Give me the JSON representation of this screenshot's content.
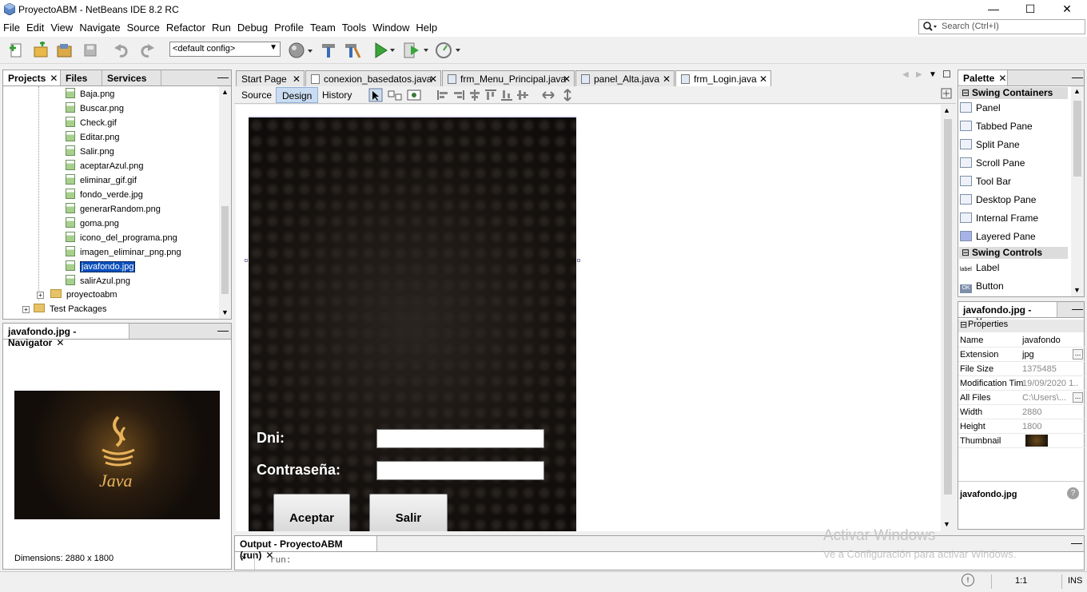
{
  "window": {
    "title": "ProyectoABM - NetBeans IDE 8.2 RC",
    "min": "—",
    "max": "☐",
    "close": "✕"
  },
  "menu": [
    "File",
    "Edit",
    "View",
    "Navigate",
    "Source",
    "Refactor",
    "Run",
    "Debug",
    "Profile",
    "Team",
    "Tools",
    "Window",
    "Help"
  ],
  "search": {
    "placeholder": "Search (Ctrl+I)"
  },
  "toolbar": {
    "config": "<default config>"
  },
  "projects": {
    "tabs": [
      "Projects",
      "Files",
      "Services"
    ],
    "files": [
      "Baja.png",
      "Buscar.png",
      "Check.gif",
      "Editar.png",
      "Salir.png",
      "aceptarAzul.png",
      "eliminar_gif.gif",
      "fondo_verde.jpg",
      "generarRandom.png",
      "goma.png",
      "icono_del_programa.png",
      "imagen_eliminar_png.png",
      "javafondo.jpg",
      "salirAzul.png"
    ],
    "package": "proyectoabm",
    "test": "Test Packages"
  },
  "navigator": {
    "title": "javafondo.jpg - Navigator",
    "dimensions": "Dimensions: 2880 x 1800",
    "logo_text": "Java"
  },
  "editor": {
    "tabs": [
      "Start Page",
      "conexion_basedatos.java",
      "frm_Menu_Principal.java",
      "panel_Alta.java",
      "frm_Login.java"
    ],
    "modes": [
      "Source",
      "Design",
      "History"
    ]
  },
  "form": {
    "dni_label": "Dni:",
    "pass_label": "Contraseña:",
    "accept": "Aceptar",
    "exit": "Salir"
  },
  "palette": {
    "title": "Palette",
    "section1": "Swing Containers",
    "containers": [
      "Panel",
      "Tabbed Pane",
      "Split Pane",
      "Scroll Pane",
      "Tool Bar",
      "Desktop Pane",
      "Internal Frame",
      "Layered Pane"
    ],
    "section2": "Swing Controls",
    "controls": [
      "Label",
      "Button"
    ],
    "label_icon": "label",
    "button_icon": "OK"
  },
  "properties": {
    "title": "javafondo.jpg - ...",
    "section": "Properties",
    "rows": [
      {
        "k": "Name",
        "v": "javafondo"
      },
      {
        "k": "Extension",
        "v": "jpg"
      },
      {
        "k": "File Size",
        "v": "1375485"
      },
      {
        "k": "Modification Tim",
        "v": "19/09/2020 1..."
      },
      {
        "k": "All Files",
        "v": "C:\\Users\\..."
      },
      {
        "k": "Width",
        "v": "2880"
      },
      {
        "k": "Height",
        "v": "1800"
      },
      {
        "k": "Thumbnail",
        "v": ""
      }
    ],
    "footer": "javafondo.jpg",
    "help": "?"
  },
  "output": {
    "title": "Output - ProyectoABM (run)",
    "text": "run:"
  },
  "watermark": {
    "line1": "Activar Windows",
    "line2": "Ve a Configuración para activar Windows."
  },
  "status": {
    "pos": "1:1",
    "mode": "INS"
  }
}
